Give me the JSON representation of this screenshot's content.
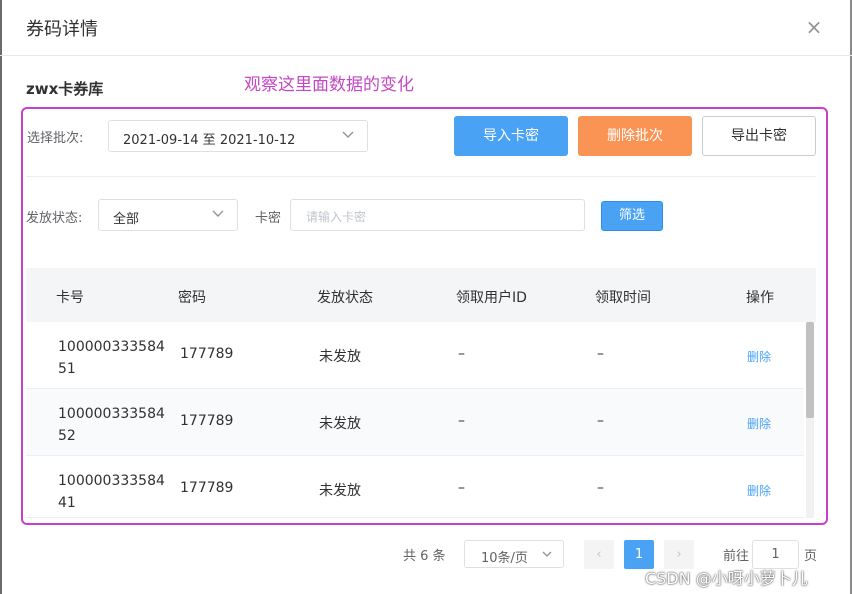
{
  "dialog": {
    "title": "券码详情",
    "close_icon": "×"
  },
  "library_title": "zwx卡券库",
  "annotation": "观察这里面数据的变化",
  "batch": {
    "label": "选择批次:",
    "value": "2021-09-14 至 2021-10-12"
  },
  "buttons": {
    "import": "导入卡密",
    "delete_batch": "删除批次",
    "export": "导出卡密",
    "filter": "筛选"
  },
  "filter": {
    "status_label": "发放状态:",
    "status_value": "全部",
    "code_label": "卡密",
    "code_placeholder": "请输入卡密"
  },
  "table": {
    "headers": [
      "卡号",
      "密码",
      "发放状态",
      "领取用户ID",
      "领取时间",
      "操作"
    ],
    "rows": [
      {
        "number": "10000033358451",
        "number_line1": "100000333584",
        "number_line2": "51",
        "password": "177789",
        "status": "未发放",
        "user_id": "–",
        "time": "–",
        "action": "删除"
      },
      {
        "number": "10000033358452",
        "number_line1": "100000333584",
        "number_line2": "52",
        "password": "177789",
        "status": "未发放",
        "user_id": "–",
        "time": "–",
        "action": "删除"
      },
      {
        "number": "10000033358441",
        "number_line1": "100000333584",
        "number_line2": "41",
        "password": "177789",
        "status": "未发放",
        "user_id": "–",
        "time": "–",
        "action": "删除"
      }
    ]
  },
  "pagination": {
    "total": "共 6 条",
    "page_size": "10条/页",
    "prev": "‹",
    "current_page": "1",
    "next": "›",
    "goto_label": "前往",
    "goto_value": "1",
    "goto_suffix": "页"
  },
  "watermark": "CSDN @小呀小萝卜儿",
  "colors": {
    "primary": "#4aa2f5",
    "warning": "#fa9455",
    "highlight": "#c83fc8",
    "annotation": "#c348c3"
  }
}
